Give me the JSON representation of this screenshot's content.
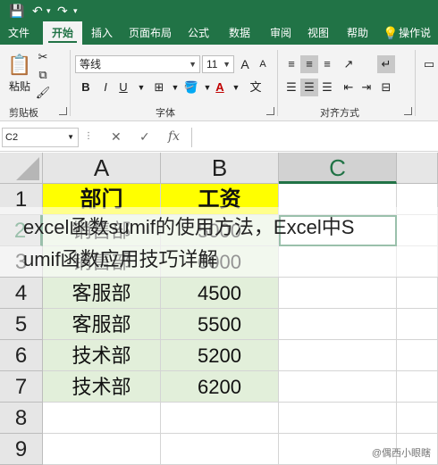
{
  "quick_access": {
    "save_icon": "save-icon",
    "undo_icon": "undo-icon",
    "redo_icon": "redo-icon"
  },
  "tabs": [
    {
      "label": "文件",
      "active": false
    },
    {
      "label": "开始",
      "active": true
    },
    {
      "label": "插入",
      "active": false
    },
    {
      "label": "页面布局",
      "active": false
    },
    {
      "label": "公式",
      "active": false
    },
    {
      "label": "数据",
      "active": false
    },
    {
      "label": "审阅",
      "active": false
    },
    {
      "label": "视图",
      "active": false
    },
    {
      "label": "帮助",
      "active": false
    },
    {
      "label": "操作说",
      "active": false
    }
  ],
  "ribbon": {
    "paste_label": "粘贴",
    "clipboard_label": "剪贴板",
    "font_name": "等线",
    "font_size": "11",
    "font_group_label": "字体",
    "align_group_label": "对齐方式",
    "bold": "B",
    "italic": "I",
    "underline": "U",
    "grow_font": "A",
    "shrink_font": "A",
    "font_color": "A"
  },
  "formula_bar": {
    "name_box": "C2",
    "cancel": "✕",
    "confirm": "✓",
    "fx": "fx",
    "value": ""
  },
  "sheet": {
    "columns": [
      "A",
      "B",
      "C"
    ],
    "selected_column": "C",
    "rows": [
      "1",
      "2",
      "3",
      "4",
      "5",
      "6",
      "7",
      "8",
      "9"
    ],
    "selected_row": "2",
    "cells": [
      [
        "部门",
        "工资"
      ],
      [
        "销售部",
        "5000"
      ],
      [
        "销售部",
        "6000"
      ],
      [
        "客服部",
        "4500"
      ],
      [
        "客服部",
        "5500"
      ],
      [
        "技术部",
        "5200"
      ],
      [
        "技术部",
        "6200"
      ],
      [
        "",
        ""
      ],
      [
        "",
        ""
      ]
    ]
  },
  "overlay_title": {
    "line1": "excel函数sumif的使用方法，Excel中S",
    "line2": "umif函数应用技巧详解"
  },
  "watermark": "@偶西小眼瞎",
  "colors": {
    "excel_green": "#217346",
    "header_fill": "#ffff00",
    "data_fill": "#e2efda"
  }
}
